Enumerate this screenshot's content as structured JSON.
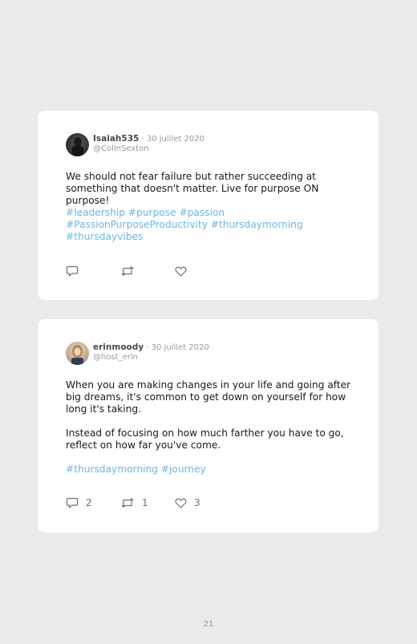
{
  "posts": [
    {
      "username": "Isaiah535",
      "date": " · 30 juillet 2020",
      "handle": "@ColinSexton",
      "paragraphs": [
        "We should not fear failure but rather succeeding at something that doesn't matter. Live for purpose ON purpose!"
      ],
      "hashtags": "#leadership #purpose #passion #PassionPurposeProductivity #thursdaymorning #thursdayvibes",
      "counts": {
        "replies": "",
        "retweets": "",
        "likes": ""
      }
    },
    {
      "username": "erinmoody",
      "date": " · 30 juillet 2020",
      "handle": "@host_erin",
      "paragraphs": [
        "When you are making changes in your life and going after big dreams, it's common to get down on yourself for how long it's taking.",
        "Instead of focusing on how much farther you have to go, reflect on how far you've come."
      ],
      "hashtags": "#thursdaymorning #journey",
      "counts": {
        "replies": "2",
        "retweets": "1",
        "likes": "3"
      }
    }
  ],
  "page_number": "21",
  "icons": [
    "reply-icon",
    "retweet-icon",
    "like-icon"
  ],
  "colors": {
    "background": "#ebeae9",
    "card": "#ffffff",
    "hashtag": "#6cb6e6",
    "meta": "#9a9a9a",
    "page_number": "#8a9aaa"
  }
}
